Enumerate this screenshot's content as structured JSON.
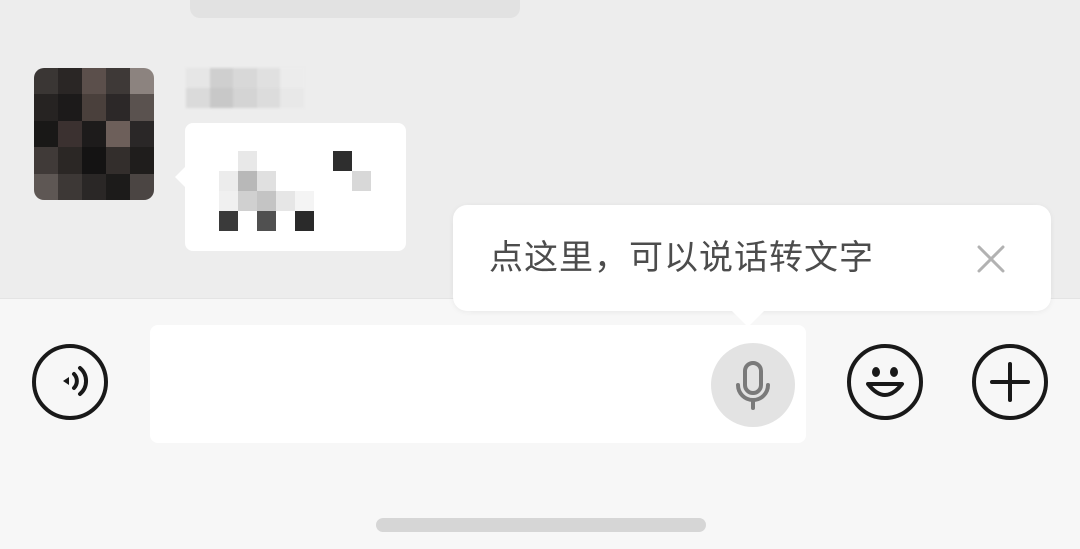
{
  "tooltip": {
    "text": "点这里，可以说话转文字",
    "close_icon": "close-icon"
  },
  "input_bar": {
    "voice_icon": "voice-mode-icon",
    "mic_icon": "microphone-icon",
    "emoji_icon": "emoji-icon",
    "plus_icon": "plus-icon",
    "input_value": ""
  },
  "colors": {
    "chat_background": "#ededed",
    "input_bar_background": "#f7f7f7",
    "bubble": "#ffffff",
    "icon_stroke": "#191919",
    "tooltip_text": "#4c4c4c"
  }
}
